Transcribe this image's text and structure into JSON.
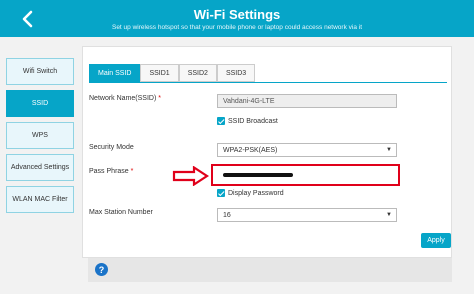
{
  "header": {
    "title": "Wi-Fi Settings",
    "subtitle": "Set up wireless hotspot so that your mobile phone or laptop could access network via it"
  },
  "sidebar": {
    "items": [
      {
        "label": "Wifi Switch",
        "active": false
      },
      {
        "label": "SSID",
        "active": true
      },
      {
        "label": "WPS",
        "active": false
      },
      {
        "label": "Advanced Settings",
        "active": false
      },
      {
        "label": "WLAN MAC Filter",
        "active": false
      }
    ]
  },
  "tabs": [
    {
      "label": "Main SSID",
      "active": true
    },
    {
      "label": "SSID1",
      "active": false
    },
    {
      "label": "SSID2",
      "active": false
    },
    {
      "label": "SSID3",
      "active": false
    }
  ],
  "form": {
    "network_name_label": "Network Name(SSID)",
    "network_name_value": "Vahdani-4G-LTE",
    "ssid_broadcast_label": "SSID Broadcast",
    "security_mode_label": "Security Mode",
    "security_mode_value": "WPA2-PSK(AES)",
    "pass_phrase_label": "Pass Phrase",
    "display_password_label": "Display Password",
    "max_station_label": "Max Station Number",
    "max_station_value": "16",
    "required_mark": "*",
    "apply_label": "Apply"
  },
  "icons": {
    "back": "chevron-left-icon",
    "help": "question-circle-icon",
    "arrow": "right-arrow-icon",
    "help_glyph": "?"
  },
  "colors": {
    "accent": "#06a5c8",
    "highlight": "#e0001a",
    "help": "#1a73c8"
  }
}
